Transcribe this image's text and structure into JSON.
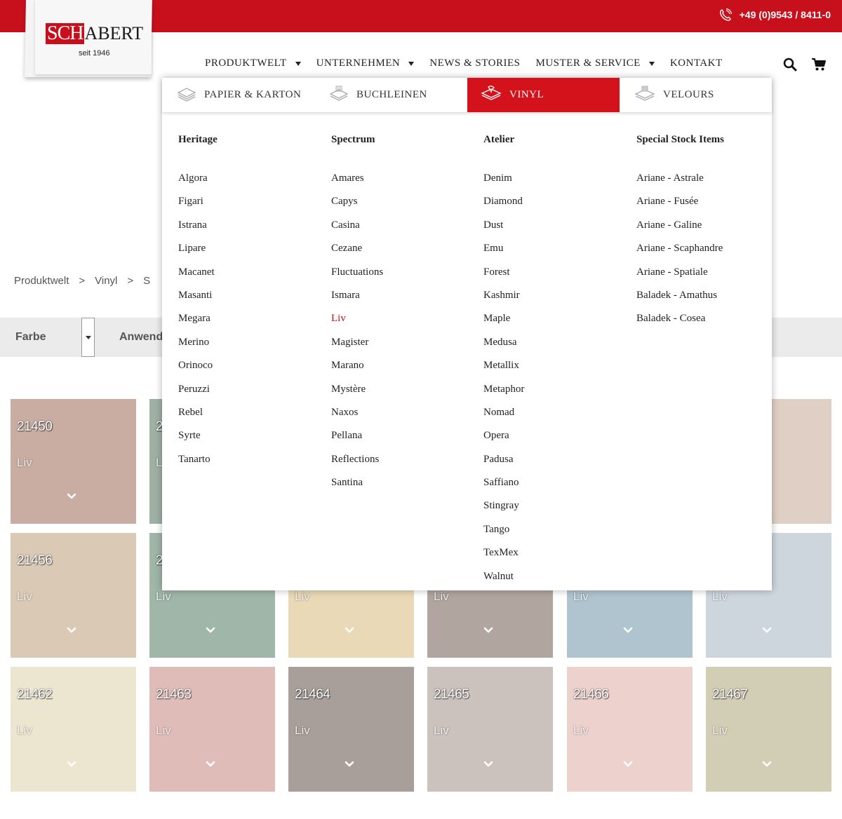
{
  "header": {
    "phone": "+49 (0)9543 / 8411-0",
    "logo_sch": "SCH",
    "logo_rest": "ABERT",
    "logo_tagline": "seit 1946"
  },
  "nav": {
    "items": [
      {
        "label": "PRODUKTWELT",
        "dropdown": true
      },
      {
        "label": "UNTERNEHMEN",
        "dropdown": true
      },
      {
        "label": "NEWS & STORIES",
        "dropdown": false
      },
      {
        "label": "MUSTER & SERVICE",
        "dropdown": true
      },
      {
        "label": "KONTAKT",
        "dropdown": false
      }
    ],
    "icons": [
      "search-icon",
      "cart-icon"
    ]
  },
  "breadcrumb": {
    "items": [
      "Produktwelt",
      "Vinyl",
      "S"
    ],
    "separator": ">"
  },
  "filters": {
    "farbe": "Farbe",
    "anwendung": "Anwend"
  },
  "mega_menu": {
    "tabs": [
      {
        "label": "PAPIER & KARTON",
        "icon": "paper-stack-icon",
        "active": false
      },
      {
        "label": "BUCHLEINEN",
        "icon": "linen-stack-icon",
        "active": false
      },
      {
        "label": "VINYL",
        "icon": "vinyl-stack-icon",
        "active": true
      },
      {
        "label": "VELOURS",
        "icon": "velours-stack-icon",
        "active": false
      }
    ],
    "columns": [
      {
        "heading": "Heritage",
        "items": [
          "Algora",
          "Figari",
          "Istrana",
          "Lipare",
          "Macanet",
          "Masanti",
          "Megara",
          "Merino",
          "Orinoco",
          "Peruzzi",
          "Rebel",
          "Syrte",
          "Tanarto"
        ]
      },
      {
        "heading": "Spectrum",
        "items": [
          "Amares",
          "Capys",
          "Casina",
          "Cezane",
          "Fluctuations",
          "Ismara",
          "Liv",
          "Magister",
          "Marano",
          "Mystère",
          "Naxos",
          "Pellana",
          "Reflections",
          "Santina"
        ],
        "current": "Liv"
      },
      {
        "heading": "Atelier",
        "items": [
          "Denim",
          "Diamond",
          "Dust",
          "Emu",
          "Forest",
          "Kashmir",
          "Maple",
          "Medusa",
          "Metallix",
          "Metaphor",
          "Nomad",
          "Opera",
          "Padusa",
          "Saffiano",
          "Stingray",
          "Tango",
          "TexMex",
          "Walnut"
        ]
      },
      {
        "heading": "Special Stock Items",
        "items": [
          "Ariane - Astrale",
          "Ariane - Fusée",
          "Ariane - Galine",
          "Ariane - Scaphandre",
          "Ariane - Spatiale",
          "Baladek - Amathus",
          "Baladek - Cosea"
        ]
      }
    ]
  },
  "swatches": [
    {
      "code": "21450",
      "name": "Liv",
      "color": "#c9ada3"
    },
    {
      "code": "2",
      "name": "L",
      "color": "#9fb0a4"
    },
    {
      "code": "",
      "name": "",
      "color": "#e4d3c6"
    },
    {
      "code": "",
      "name": "",
      "color": "#e4d3c6"
    },
    {
      "code": "",
      "name": "",
      "color": "#e4d3c6"
    },
    {
      "code": "",
      "name": "",
      "color": "#e0cfc4"
    },
    {
      "code": "21456",
      "name": "Liv",
      "color": "#dacab5"
    },
    {
      "code": "2",
      "name": "Liv",
      "color": "#9fb6a8"
    },
    {
      "code": "",
      "name": "Liv",
      "color": "#e9d9b7"
    },
    {
      "code": "",
      "name": "Liv",
      "color": "#b0a59f"
    },
    {
      "code": "",
      "name": "Liv",
      "color": "#b0c4d0"
    },
    {
      "code": "",
      "name": "Liv",
      "color": "#cdd6dd"
    },
    {
      "code": "21462",
      "name": "Liv",
      "color": "#ece6d1"
    },
    {
      "code": "21463",
      "name": "Liv",
      "color": "#e0bcb9"
    },
    {
      "code": "21464",
      "name": "Liv",
      "color": "#a89f9b"
    },
    {
      "code": "21465",
      "name": "Liv",
      "color": "#cbc1bd"
    },
    {
      "code": "21466",
      "name": "Liv",
      "color": "#edd1cd"
    },
    {
      "code": "21467",
      "name": "Liv",
      "color": "#d2cdb5"
    }
  ],
  "colors": {
    "brand_red": "#c8101d",
    "active_tab_red": "#d4121c",
    "filter_bar": "#ebebeb"
  }
}
